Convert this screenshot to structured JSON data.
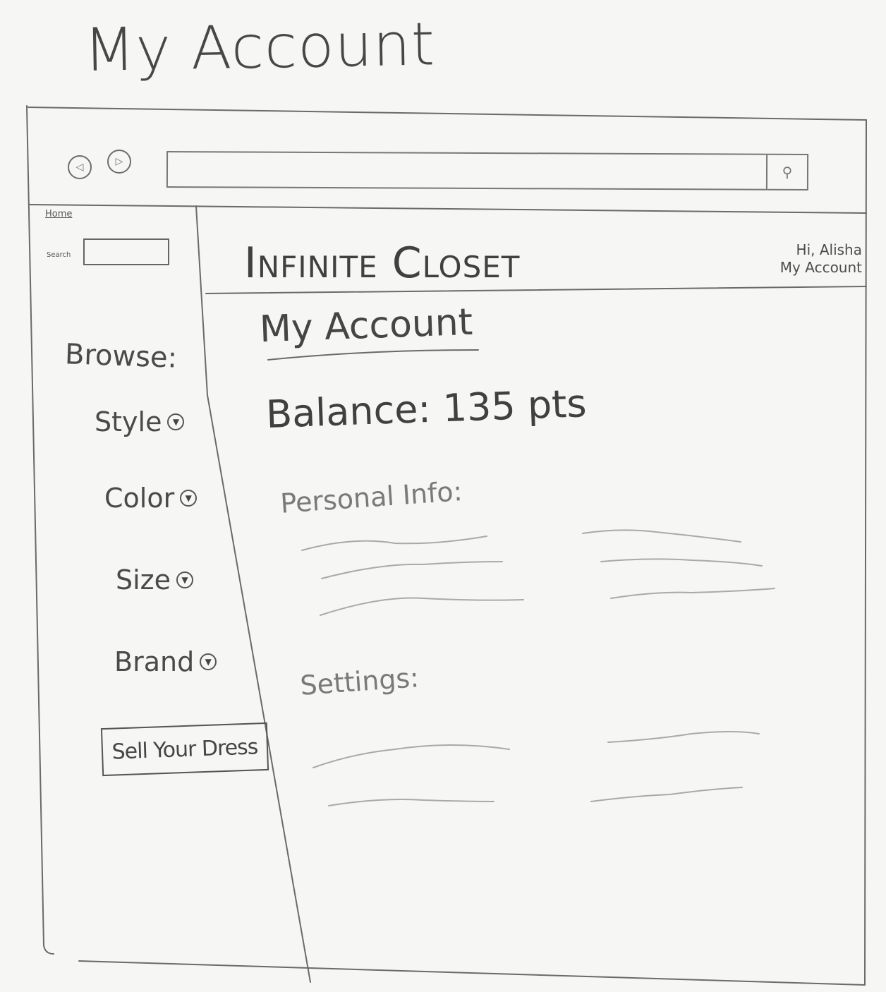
{
  "page_heading": "My Account",
  "browser": {
    "back_icon": "back-arrow-icon",
    "forward_icon": "forward-arrow-icon",
    "search_icon": "search-icon",
    "search_glyph": "⚲"
  },
  "sidebar": {
    "home_link": "Home",
    "search_label": "Search",
    "browse_title": "Browse:",
    "filters": [
      {
        "label": "Style"
      },
      {
        "label": "Color"
      },
      {
        "label": "Size"
      },
      {
        "label": "Brand"
      }
    ],
    "sell_button": "Sell Your Dress"
  },
  "header": {
    "site_name": "Infinite Closet",
    "greeting": "Hi, Alisha",
    "account_link": "My Account"
  },
  "main": {
    "title": "My Account",
    "balance": "Balance: 135 pts",
    "personal_info_label": "Personal Info:",
    "settings_label": "Settings:"
  }
}
